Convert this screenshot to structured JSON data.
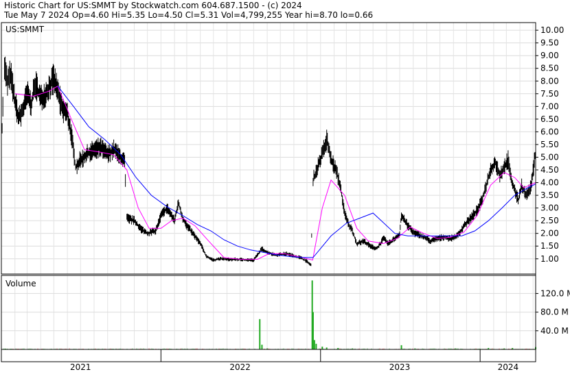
{
  "header": {
    "line1": "Historic Chart for US:SMMT by Stockwatch.com 604.687.1500 - (c) 2024",
    "line2": "Tue May  7 2024  Op=4.60  Hi=5.35  Lo=4.50  Cl=5.31  Vol=4,799,255  Year hi=8.70  lo=0.66"
  },
  "chart_data": [
    {
      "type": "line",
      "panel": "price",
      "title": "US:SMMT",
      "ylim": [
        0.4,
        10.3
      ],
      "y_ticks": [
        "10.00",
        "9.50",
        "9.00",
        "8.50",
        "8.00",
        "7.50",
        "7.00",
        "6.50",
        "6.00",
        "5.50",
        "5.00",
        "4.50",
        "4.00",
        "3.50",
        "3.00",
        "2.50",
        "2.00",
        "1.50",
        "1.00"
      ],
      "x_start": "2021-01-01",
      "x_end": "2024-05-07",
      "grid": true,
      "series": [
        {
          "color": "#000000",
          "style": "high-low bars",
          "points": [
            [
              "2021-01-01",
              5.3
            ],
            [
              "2021-01-08",
              8.6
            ],
            [
              "2021-01-15",
              7.9
            ],
            [
              "2021-01-22",
              8.3
            ],
            [
              "2021-02-01",
              7.2
            ],
            [
              "2021-02-10",
              6.5
            ],
            [
              "2021-02-20",
              6.9
            ],
            [
              "2021-03-01",
              7.5
            ],
            [
              "2021-03-10",
              7.1
            ],
            [
              "2021-03-20",
              7.9
            ],
            [
              "2021-04-01",
              7.3
            ],
            [
              "2021-04-15",
              7.6
            ],
            [
              "2021-05-01",
              8.1
            ],
            [
              "2021-05-10",
              7.6
            ],
            [
              "2021-05-20",
              6.9
            ],
            [
              "2021-06-01",
              6.7
            ],
            [
              "2021-06-10",
              5.9
            ],
            [
              "2021-06-20",
              4.6
            ],
            [
              "2021-07-01",
              4.9
            ],
            [
              "2021-07-15",
              5.1
            ],
            [
              "2021-08-01",
              5.3
            ],
            [
              "2021-08-15",
              5.4
            ],
            [
              "2021-09-01",
              5.1
            ],
            [
              "2021-09-15",
              5.3
            ],
            [
              "2021-10-01",
              5.0
            ],
            [
              "2021-10-10",
              4.8
            ],
            [
              "2021-10-15",
              2.6
            ],
            [
              "2021-11-01",
              2.5
            ],
            [
              "2021-11-15",
              2.2
            ],
            [
              "2021-12-01",
              2.0
            ],
            [
              "2021-12-20",
              2.1
            ],
            [
              "2022-01-01",
              2.7
            ],
            [
              "2022-01-15",
              3.0
            ],
            [
              "2022-02-01",
              2.5
            ],
            [
              "2022-02-10",
              3.2
            ],
            [
              "2022-02-20",
              2.6
            ],
            [
              "2022-03-01",
              2.3
            ],
            [
              "2022-03-15",
              2.0
            ],
            [
              "2022-04-01",
              1.6
            ],
            [
              "2022-04-15",
              1.1
            ],
            [
              "2022-05-01",
              0.95
            ],
            [
              "2022-05-15",
              1.0
            ],
            [
              "2022-06-01",
              0.98
            ],
            [
              "2022-07-01",
              0.97
            ],
            [
              "2022-08-01",
              0.95
            ],
            [
              "2022-08-20",
              1.4
            ],
            [
              "2022-09-01",
              1.25
            ],
            [
              "2022-09-20",
              1.15
            ],
            [
              "2022-10-15",
              1.2
            ],
            [
              "2022-11-15",
              1.05
            ],
            [
              "2022-12-01",
              0.9
            ],
            [
              "2022-12-10",
              0.75
            ],
            [
              "2022-12-15",
              4.1
            ],
            [
              "2022-12-25",
              4.6
            ],
            [
              "2023-01-05",
              5.1
            ],
            [
              "2023-01-15",
              5.7
            ],
            [
              "2023-01-25",
              4.9
            ],
            [
              "2023-02-05",
              4.5
            ],
            [
              "2023-02-15",
              3.9
            ],
            [
              "2023-02-25",
              2.8
            ],
            [
              "2023-03-05",
              2.4
            ],
            [
              "2023-03-15",
              2.1
            ],
            [
              "2023-03-25",
              1.6
            ],
            [
              "2023-04-10",
              1.7
            ],
            [
              "2023-04-25",
              1.5
            ],
            [
              "2023-05-10",
              1.4
            ],
            [
              "2023-05-25",
              1.8
            ],
            [
              "2023-06-05",
              1.6
            ],
            [
              "2023-06-20",
              1.8
            ],
            [
              "2023-07-01",
              2.0
            ],
            [
              "2023-07-05",
              2.7
            ],
            [
              "2023-07-20",
              2.3
            ],
            [
              "2023-08-05",
              2.0
            ],
            [
              "2023-08-20",
              1.9
            ],
            [
              "2023-09-10",
              1.7
            ],
            [
              "2023-09-25",
              1.8
            ],
            [
              "2023-10-10",
              1.85
            ],
            [
              "2023-10-25",
              1.8
            ],
            [
              "2023-11-10",
              1.9
            ],
            [
              "2023-11-25",
              2.3
            ],
            [
              "2023-12-10",
              2.6
            ],
            [
              "2023-12-25",
              2.9
            ],
            [
              "2024-01-05",
              3.3
            ],
            [
              "2024-01-15",
              3.9
            ],
            [
              "2024-01-25",
              4.5
            ],
            [
              "2024-02-05",
              4.8
            ],
            [
              "2024-02-15",
              4.3
            ],
            [
              "2024-02-25",
              4.6
            ],
            [
              "2024-03-05",
              4.9
            ],
            [
              "2024-03-12",
              4.1
            ],
            [
              "2024-03-20",
              3.7
            ],
            [
              "2024-03-28",
              3.3
            ],
            [
              "2024-04-05",
              3.9
            ],
            [
              "2024-04-15",
              3.5
            ],
            [
              "2024-04-25",
              3.8
            ],
            [
              "2024-05-01",
              4.4
            ],
            [
              "2024-05-07",
              5.31
            ]
          ]
        },
        {
          "color": "#ff00ff",
          "style": "line",
          "points": [
            [
              "2021-02-01",
              7.5
            ],
            [
              "2021-03-15",
              7.4
            ],
            [
              "2021-04-20",
              7.6
            ],
            [
              "2021-05-10",
              7.8
            ],
            [
              "2021-06-10",
              6.5
            ],
            [
              "2021-07-10",
              5.3
            ],
            [
              "2021-08-15",
              5.2
            ],
            [
              "2021-09-15",
              5.1
            ],
            [
              "2021-10-15",
              4.5
            ],
            [
              "2021-11-10",
              3.0
            ],
            [
              "2021-12-05",
              2.2
            ],
            [
              "2022-01-01",
              2.2
            ],
            [
              "2022-01-25",
              2.5
            ],
            [
              "2022-02-20",
              2.6
            ],
            [
              "2022-03-20",
              2.3
            ],
            [
              "2022-04-20",
              1.7
            ],
            [
              "2022-05-25",
              1.05
            ],
            [
              "2022-07-01",
              0.98
            ],
            [
              "2022-08-10",
              0.98
            ],
            [
              "2022-09-05",
              1.2
            ],
            [
              "2022-10-10",
              1.2
            ],
            [
              "2022-11-20",
              1.05
            ],
            [
              "2022-12-14",
              0.95
            ],
            [
              "2023-01-05",
              3.0
            ],
            [
              "2023-01-25",
              4.1
            ],
            [
              "2023-02-25",
              3.5
            ],
            [
              "2023-03-25",
              2.2
            ],
            [
              "2023-04-20",
              1.7
            ],
            [
              "2023-05-25",
              1.6
            ],
            [
              "2023-06-25",
              1.8
            ],
            [
              "2023-07-25",
              2.25
            ],
            [
              "2023-08-25",
              2.0
            ],
            [
              "2023-09-25",
              1.8
            ],
            [
              "2023-10-25",
              1.85
            ],
            [
              "2023-11-25",
              2.05
            ],
            [
              "2023-12-25",
              2.7
            ],
            [
              "2024-01-25",
              3.9
            ],
            [
              "2024-02-25",
              4.4
            ],
            [
              "2024-03-20",
              4.2
            ],
            [
              "2024-04-10",
              3.8
            ],
            [
              "2024-05-07",
              4.0
            ]
          ]
        },
        {
          "color": "#0000ff",
          "style": "line",
          "points": [
            [
              "2021-05-10",
              7.8
            ],
            [
              "2021-06-15",
              7.0
            ],
            [
              "2021-07-20",
              6.2
            ],
            [
              "2021-08-25",
              5.7
            ],
            [
              "2021-10-01",
              5.1
            ],
            [
              "2021-11-05",
              4.2
            ],
            [
              "2021-12-10",
              3.5
            ],
            [
              "2022-01-15",
              3.05
            ],
            [
              "2022-02-20",
              2.7
            ],
            [
              "2022-03-25",
              2.35
            ],
            [
              "2022-04-25",
              2.1
            ],
            [
              "2022-05-25",
              1.75
            ],
            [
              "2022-06-25",
              1.5
            ],
            [
              "2022-07-25",
              1.35
            ],
            [
              "2022-08-25",
              1.25
            ],
            [
              "2022-09-25",
              1.15
            ],
            [
              "2022-10-25",
              1.08
            ],
            [
              "2022-11-25",
              1.05
            ],
            [
              "2022-12-15",
              1.05
            ],
            [
              "2023-01-25",
              1.9
            ],
            [
              "2023-03-01",
              2.4
            ],
            [
              "2023-04-01",
              2.6
            ],
            [
              "2023-05-01",
              2.8
            ],
            [
              "2023-05-20",
              2.5
            ],
            [
              "2023-06-20",
              2.0
            ],
            [
              "2023-07-20",
              1.9
            ],
            [
              "2023-08-20",
              1.9
            ],
            [
              "2023-09-20",
              1.9
            ],
            [
              "2023-10-20",
              1.9
            ],
            [
              "2023-11-20",
              1.9
            ],
            [
              "2023-12-20",
              2.1
            ],
            [
              "2024-01-20",
              2.5
            ],
            [
              "2024-02-20",
              3.0
            ],
            [
              "2024-03-20",
              3.5
            ],
            [
              "2024-04-20",
              3.8
            ],
            [
              "2024-05-07",
              3.95
            ]
          ]
        }
      ]
    },
    {
      "type": "bar",
      "panel": "volume",
      "title": "Volume",
      "ylim": [
        0,
        150
      ],
      "y_ticks": [
        "120.0 M",
        "80.0 M",
        "40.0 M"
      ],
      "color": "#22aa22",
      "spikes": [
        [
          "2021-01-10",
          1.5
        ],
        [
          "2021-04-10",
          1.0
        ],
        [
          "2021-09-05",
          0.8
        ],
        [
          "2022-01-20",
          1.0
        ],
        [
          "2022-08-15",
          65
        ],
        [
          "2022-08-20",
          10
        ],
        [
          "2022-09-01",
          2
        ],
        [
          "2022-12-13",
          148
        ],
        [
          "2022-12-15",
          80
        ],
        [
          "2022-12-18",
          20
        ],
        [
          "2022-12-22",
          12
        ],
        [
          "2023-01-05",
          6
        ],
        [
          "2023-01-15",
          4
        ],
        [
          "2023-02-10",
          3
        ],
        [
          "2023-03-15",
          2
        ],
        [
          "2023-07-05",
          9
        ],
        [
          "2023-08-05",
          2
        ],
        [
          "2023-11-05",
          2
        ],
        [
          "2024-01-20",
          3
        ],
        [
          "2024-02-25",
          2
        ],
        [
          "2024-03-15",
          3
        ],
        [
          "2024-05-07",
          5
        ]
      ]
    }
  ],
  "x_axis": {
    "labels": [
      {
        "text": "2021",
        "date": "2021-07-01"
      },
      {
        "text": "2022",
        "date": "2022-07-01"
      },
      {
        "text": "2023",
        "date": "2023-07-01"
      },
      {
        "text": "2024",
        "date": "2024-03-05"
      }
    ],
    "dividers": [
      "2022-01-01",
      "2023-01-01",
      "2024-01-01"
    ]
  }
}
